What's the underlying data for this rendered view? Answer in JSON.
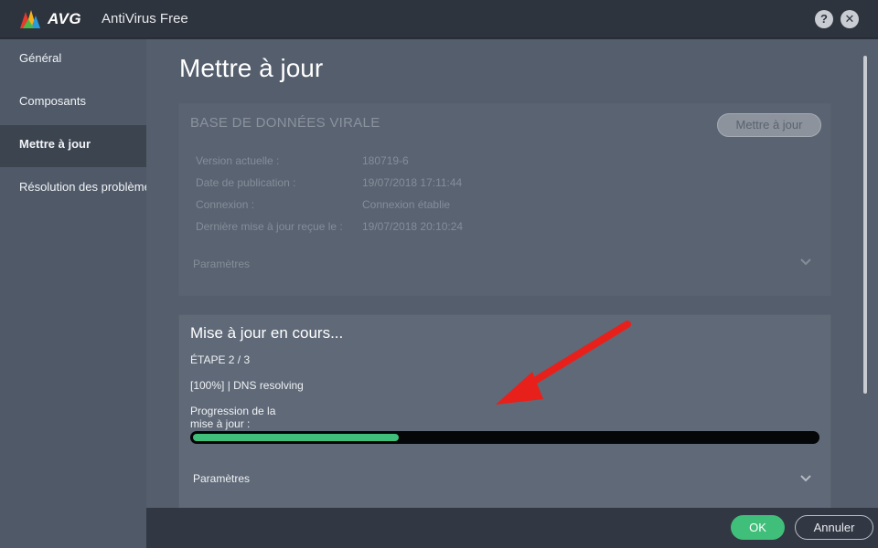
{
  "titlebar": {
    "brand": "AVG",
    "app_title": "AntiVirus Free",
    "help_label": "?",
    "close_label": "✕"
  },
  "sidebar": {
    "items": [
      {
        "label": "Général",
        "active": false
      },
      {
        "label": "Composants",
        "active": false
      },
      {
        "label": "Mettre à jour",
        "active": true
      },
      {
        "label": "Résolution des problèmes",
        "active": false
      }
    ]
  },
  "main": {
    "page_title": "Mettre à jour",
    "virus_db": {
      "title": "BASE DE DONNÉES VIRALE",
      "update_button": "Mettre à jour",
      "rows": [
        {
          "label": "Version actuelle :",
          "value": "180719-6"
        },
        {
          "label": "Date de publication :",
          "value": "19/07/2018 17:11:44"
        },
        {
          "label": "Connexion :",
          "value": "Connexion établie"
        },
        {
          "label": "Dernière mise à jour reçue le :",
          "value": "19/07/2018 20:10:24"
        }
      ],
      "params_label": "Paramètres"
    },
    "update_progress": {
      "title": "Mise à jour en cours...",
      "step": "ÉTAPE 2 / 3",
      "status": "[100%] | DNS resolving",
      "progress_label": "Progression de la mise à jour :",
      "progress_fraction": 0.33,
      "params_label": "Paramètres"
    }
  },
  "footer": {
    "ok_label": "OK",
    "cancel_label": "Annuler"
  },
  "colors": {
    "accent_green": "#3fbf7a",
    "arrow_red": "#e8201b"
  },
  "icons": {
    "logo": "avg-logo-icon",
    "chevron": "chevron-down-icon",
    "annotation": "red-arrow-icon"
  }
}
